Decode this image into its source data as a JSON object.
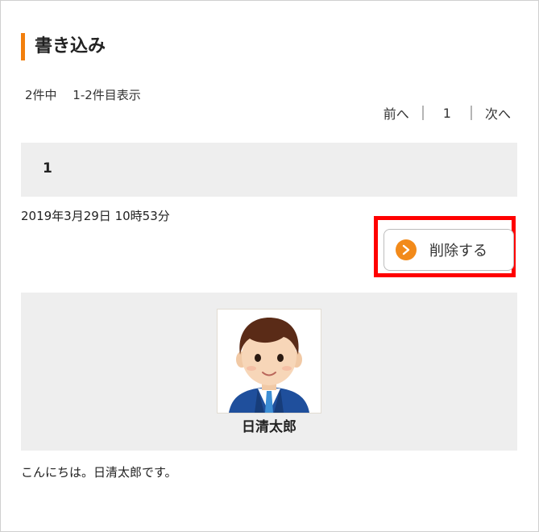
{
  "section": {
    "title": "書き込み"
  },
  "listing": {
    "count_text": "2件中　 1-2件目表示"
  },
  "pager": {
    "prev_label": "前へ",
    "current_page": "1",
    "next_label": "次へ"
  },
  "post": {
    "number": "1",
    "date": "2019年3月29日 10時53分",
    "delete_label": "削除する",
    "author_name": "日清太郎",
    "message": "こんにちは。日清太郎です。"
  },
  "colors": {
    "accent": "#f27f0c",
    "highlight": "#ff0000",
    "panel": "#eeeeee"
  }
}
